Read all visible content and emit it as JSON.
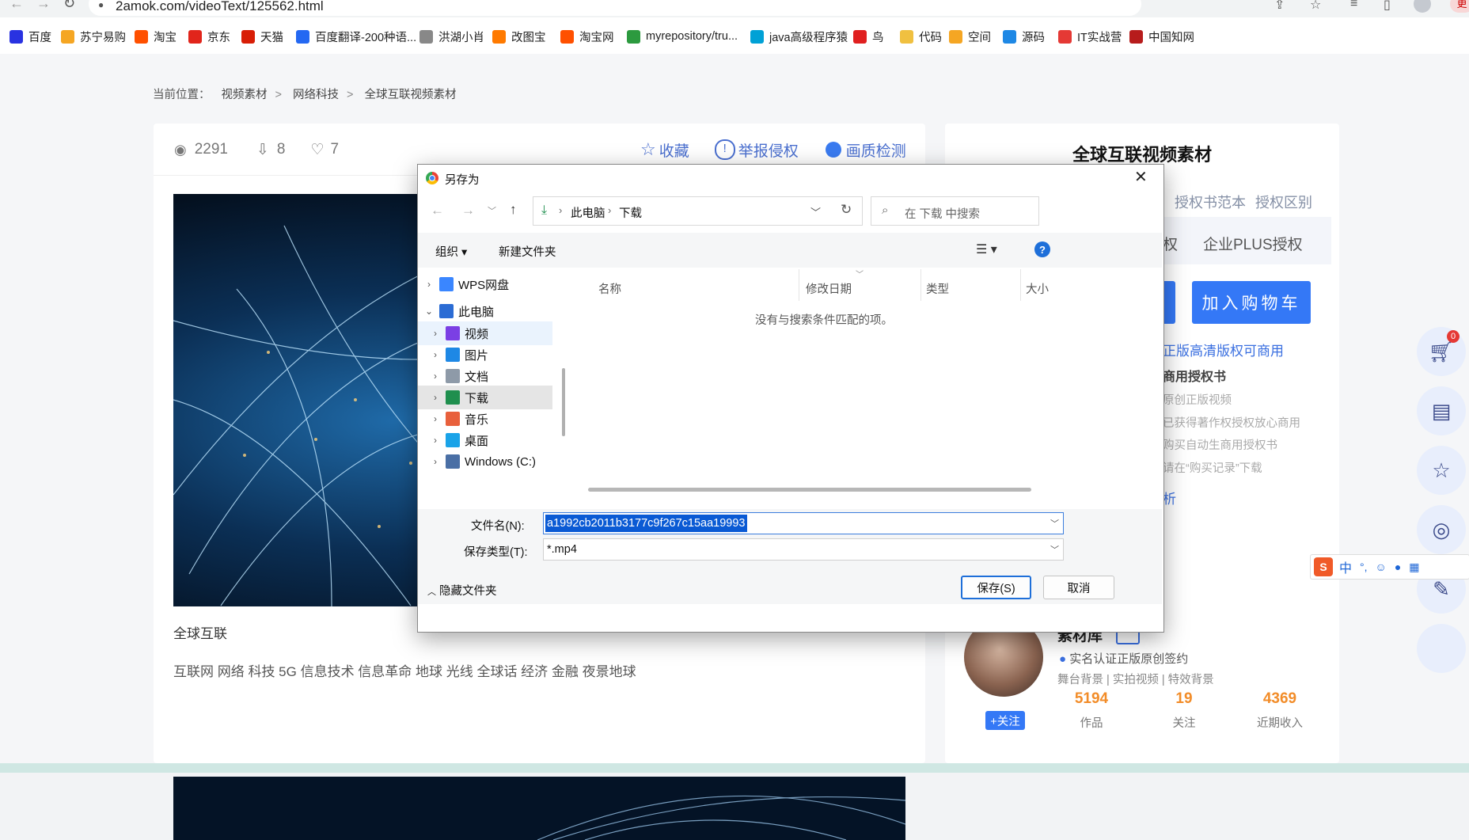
{
  "browser": {
    "url": "2amok.com/videoText/125562.html",
    "profile_btn": "更",
    "bookmarks": [
      {
        "label": "百度",
        "color": "#2932e1"
      },
      {
        "label": "苏宁易购",
        "color": "#f5a623"
      },
      {
        "label": "淘宝",
        "color": "#ff5000"
      },
      {
        "label": "京东",
        "color": "#e1251b"
      },
      {
        "label": "天猫",
        "color": "#d81e06"
      },
      {
        "label": "百度翻译-200种语...",
        "color": "#2468f2"
      },
      {
        "label": "洪湖小肖",
        "color": "#888888"
      },
      {
        "label": "改图宝",
        "color": "#ff7a00"
      },
      {
        "label": "淘宝网",
        "color": "#ff5000"
      },
      {
        "label": "myrepository/tru...",
        "color": "#2c9a3f"
      },
      {
        "label": "java高级程序猿",
        "color": "#00a1d6"
      },
      {
        "label": "鸟",
        "color": "#e02020"
      },
      {
        "label": "代码",
        "color": "#f0c040"
      },
      {
        "label": "空间",
        "color": "#f5a623"
      },
      {
        "label": "源码",
        "color": "#1e88e5"
      },
      {
        "label": "IT实战营",
        "color": "#e53935"
      },
      {
        "label": "中国知网",
        "color": "#b71c1c"
      }
    ]
  },
  "breadcrumb": {
    "prefix": "当前位置：",
    "items": [
      "视频素材",
      "网络科技",
      "全球互联视频素材"
    ]
  },
  "stats": {
    "views": "2291",
    "downloads": "8",
    "likes": "7"
  },
  "actions": {
    "favorite": "收藏",
    "report": "举报侵权",
    "quality": "画质检测"
  },
  "video": {
    "title": "全球互联",
    "tags": "互联网 网络 科技 5G 信息技术 信息革命 地球 光线 全球话 经济 金融 夜景地球"
  },
  "right_panel": {
    "title": "全球互联视频素材",
    "license_sample": "授权书范本",
    "license_diff": "授权区别",
    "tab_partial": "权",
    "enterprise": "企业PLUS授权",
    "add_cart": "加入购物车",
    "hd_line": "正版高清版权可商用",
    "cert_title": "商用授权书",
    "bullets": [
      "原创正版视频",
      "已获得著作权授权放心商用",
      "购买自动生商用授权书",
      "请在“购买记录”下载"
    ],
    "partial_link": "析"
  },
  "author": {
    "name": "素材库",
    "verified": "实名认证正版原创签约",
    "categories": "舞台背景 | 实拍视频 | 特效背景",
    "follow": "+关注",
    "works": "5194",
    "works_label": "作品",
    "follows": "19",
    "follows_label": "关注",
    "income": "4369",
    "income_label": "近期收入"
  },
  "cart_badge": "0",
  "dialog": {
    "title": "另存为",
    "path": [
      "此电脑",
      "下载"
    ],
    "search_placeholder": "在 下载 中搜索",
    "organize": "组织",
    "new_folder": "新建文件夹",
    "help": "?",
    "columns": [
      "名称",
      "修改日期",
      "类型",
      "大小"
    ],
    "empty_msg": "没有与搜索条件匹配的项。",
    "tree": [
      {
        "label": "WPS网盘",
        "level": 0,
        "color": "#3a86ff"
      },
      {
        "label": "此电脑",
        "level": 0,
        "color": "#2b6cd4"
      },
      {
        "label": "视频",
        "level": 1,
        "color": "#7b3fe4"
      },
      {
        "label": "图片",
        "level": 1,
        "color": "#1e88e5"
      },
      {
        "label": "文档",
        "level": 1,
        "color": "#8e9aa8"
      },
      {
        "label": "下载",
        "level": 1,
        "color": "#1f8f4e"
      },
      {
        "label": "音乐",
        "level": 1,
        "color": "#e8603c"
      },
      {
        "label": "桌面",
        "level": 1,
        "color": "#1aa3e8"
      },
      {
        "label": "Windows (C:)",
        "level": 1,
        "color": "#4a6fa5"
      }
    ],
    "filename_label": "文件名(N):",
    "filename": "a1992cb2011b3177c9f267c15aa19993",
    "type_label": "保存类型(T):",
    "type": "*.mp4",
    "hide_folders": "隐藏文件夹",
    "save": "保存(S)",
    "cancel": "取消"
  },
  "ime": {
    "label": "中"
  }
}
